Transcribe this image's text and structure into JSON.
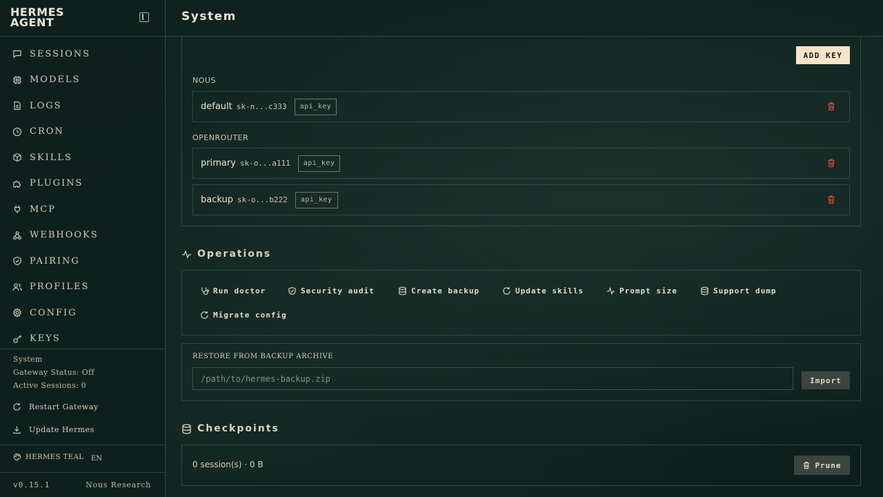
{
  "sidebar": {
    "brand_line1": "HERMES",
    "brand_line2": "AGENT",
    "nav": [
      {
        "label": "SESSIONS",
        "icon": "chat-icon"
      },
      {
        "label": "MODELS",
        "icon": "chip-icon"
      },
      {
        "label": "LOGS",
        "icon": "document-icon"
      },
      {
        "label": "CRON",
        "icon": "clock-icon"
      },
      {
        "label": "SKILLS",
        "icon": "package-icon"
      },
      {
        "label": "PLUGINS",
        "icon": "puzzle-icon"
      },
      {
        "label": "MCP",
        "icon": "plug-icon"
      },
      {
        "label": "WEBHOOKS",
        "icon": "webhook-icon"
      },
      {
        "label": "PAIRING",
        "icon": "shield-icon"
      },
      {
        "label": "PROFILES",
        "icon": "users-icon"
      },
      {
        "label": "CONFIG",
        "icon": "gear-icon"
      },
      {
        "label": "KEYS",
        "icon": "key-icon"
      }
    ],
    "system": {
      "title": "System",
      "gateway_status": "Gateway Status: Off",
      "active_sessions": "Active Sessions: 0",
      "restart_label": "Restart Gateway",
      "update_label": "Update Hermes"
    },
    "theme_label": "HERMES TEAL",
    "language": "EN",
    "version": "v0.15.1",
    "credit": "Nous Research"
  },
  "header": {
    "title": "System"
  },
  "keys": {
    "add_label": "ADD KEY",
    "groups": [
      {
        "name": "NOUS",
        "rows": [
          {
            "name": "default",
            "mask": "sk-n...c333",
            "type": "api_key"
          }
        ]
      },
      {
        "name": "OPENROUTER",
        "rows": [
          {
            "name": "primary",
            "mask": "sk-o...a111",
            "type": "api_key"
          },
          {
            "name": "backup",
            "mask": "sk-o...b222",
            "type": "api_key"
          }
        ]
      }
    ]
  },
  "operations": {
    "title": "Operations",
    "buttons": [
      "Run doctor",
      "Security audit",
      "Create backup",
      "Update skills",
      "Prompt size",
      "Support dump",
      "Migrate config"
    ]
  },
  "restore": {
    "label": "RESTORE FROM BACKUP ARCHIVE",
    "placeholder": "/path/to/hermes-backup.zip",
    "import_label": "Import"
  },
  "checkpoints": {
    "title": "Checkpoints",
    "summary": "0 session(s) · 0 B",
    "prune_label": "Prune"
  },
  "colors": {
    "background": "#0f2220",
    "accent_button": "#f6e3c8",
    "danger": "#e0453a",
    "text": "#e8e2d0"
  }
}
